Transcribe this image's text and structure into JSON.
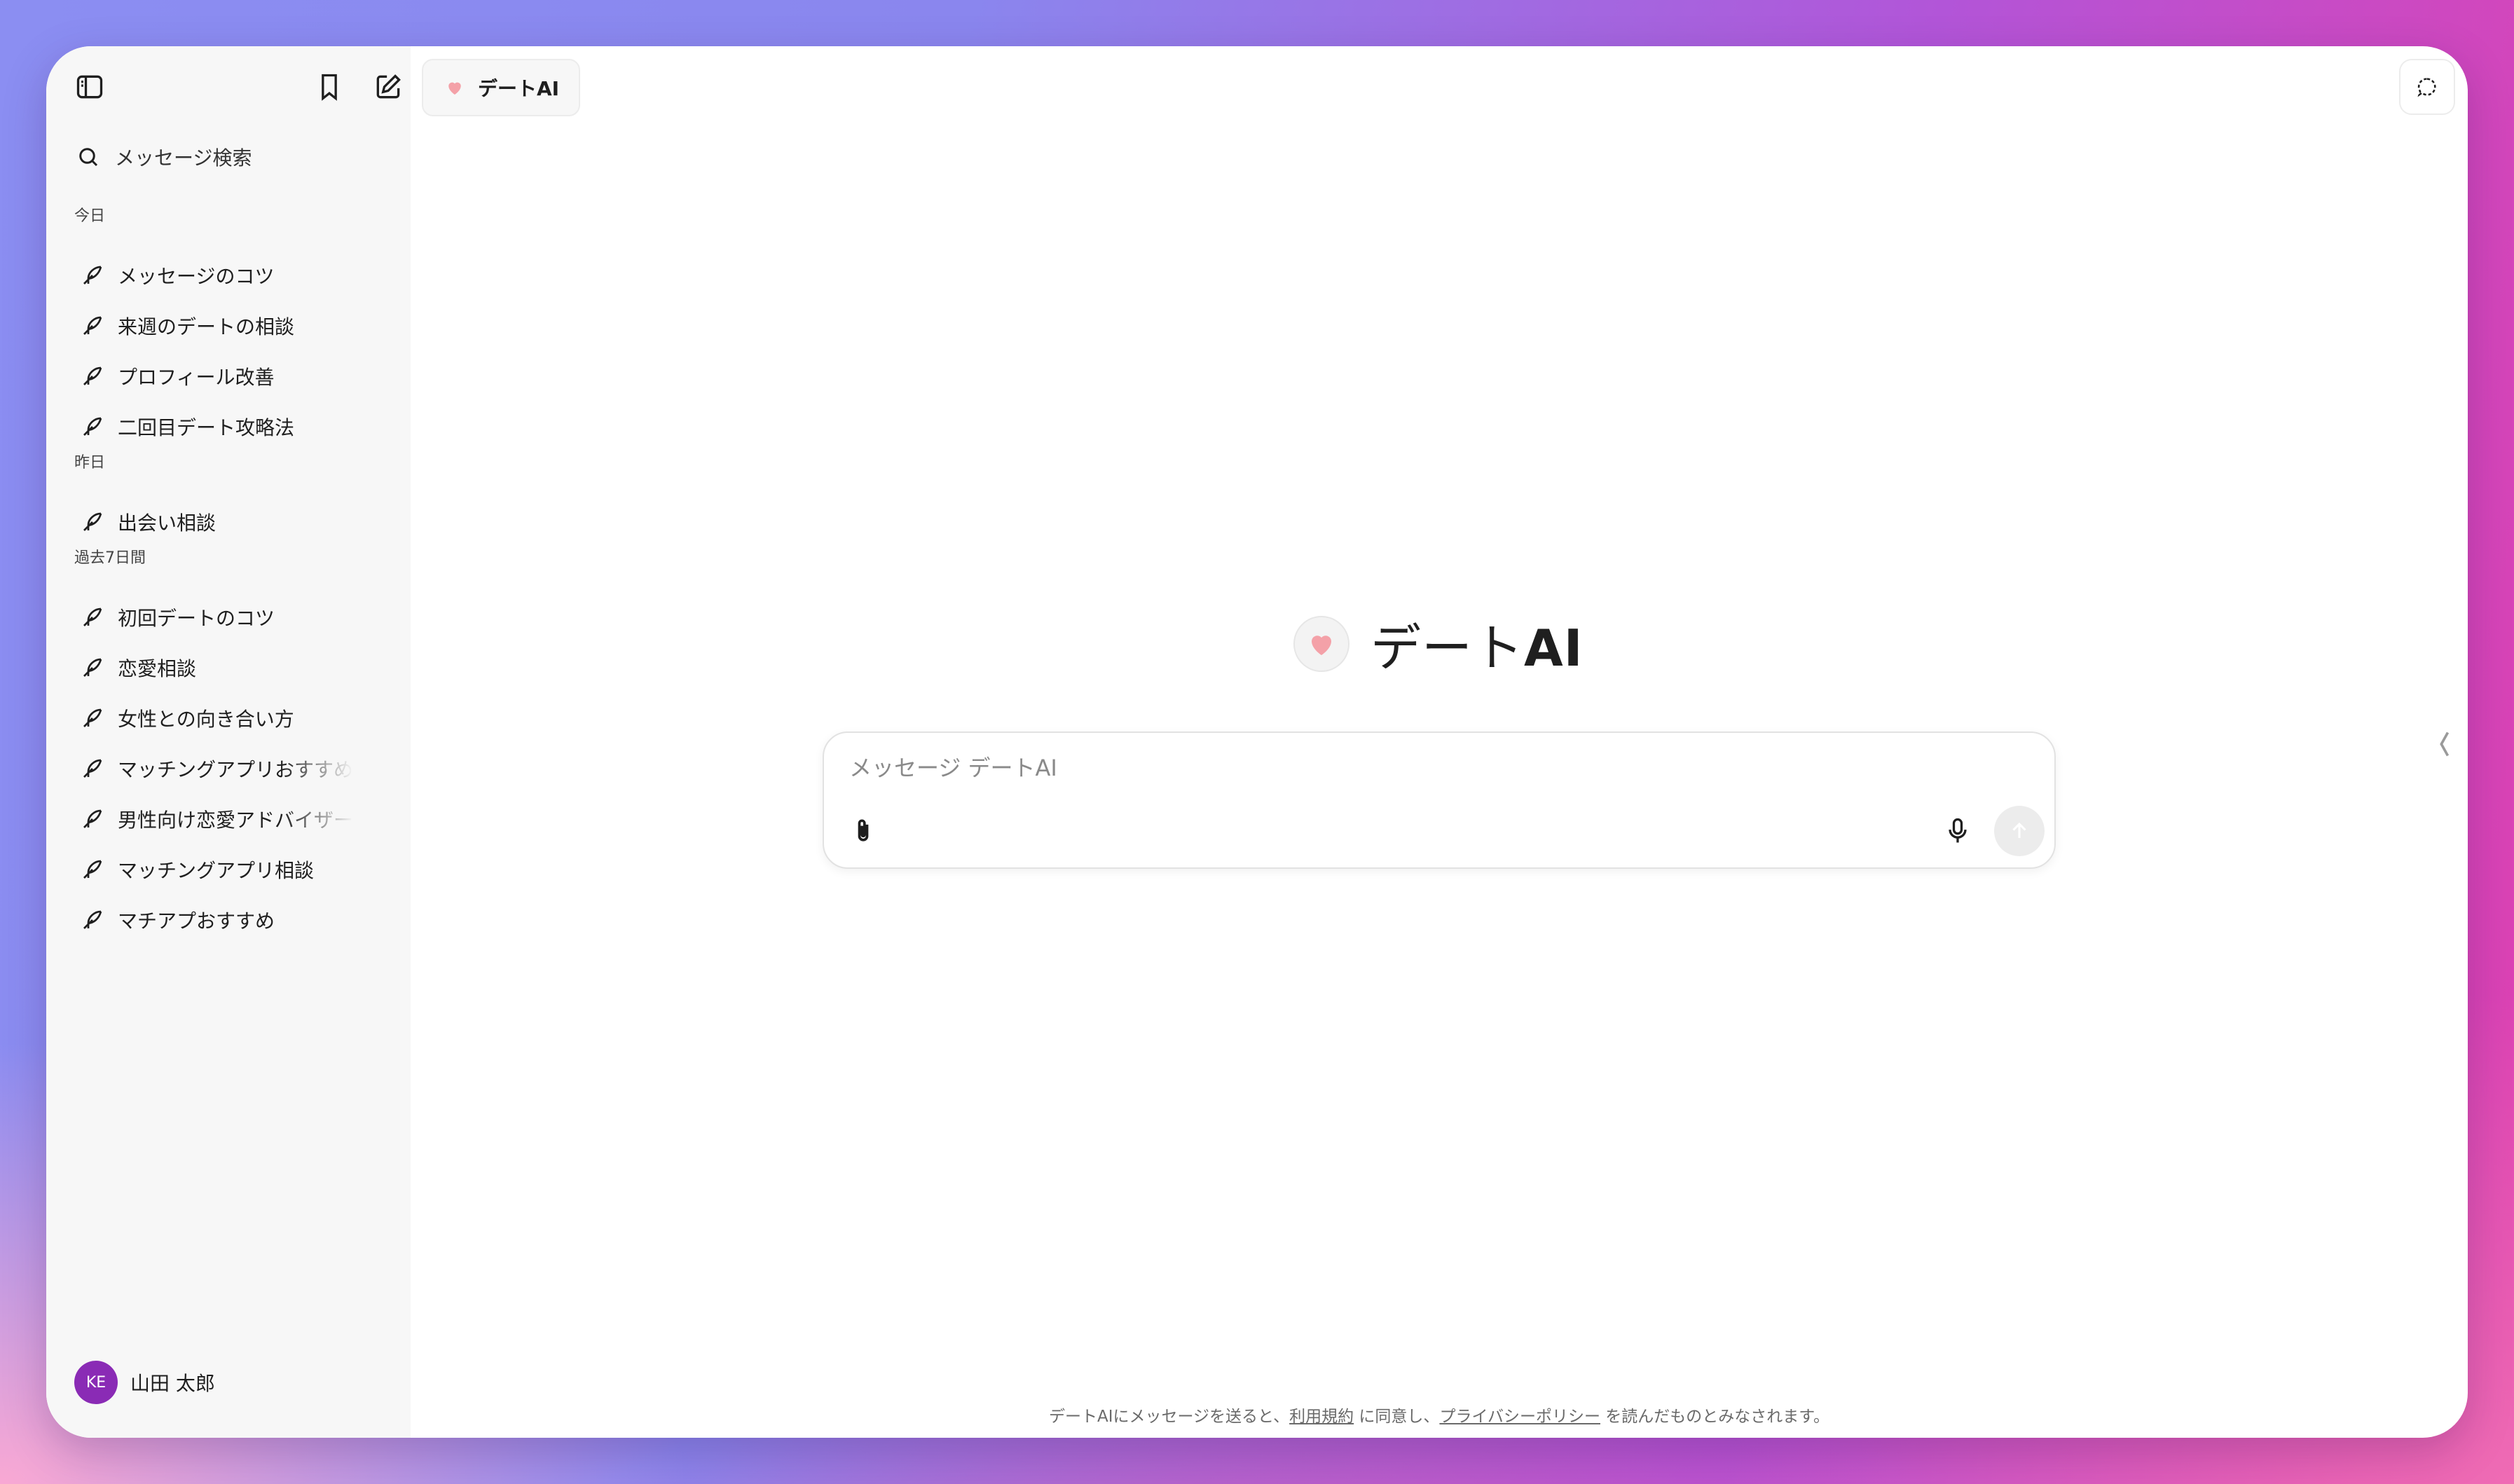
{
  "app": {
    "name": "デートAI"
  },
  "sidebar": {
    "search_label": "メッセージ検索",
    "sections": [
      {
        "label": "今日",
        "items": [
          "メッセージのコツ",
          "来週のデートの相談",
          "プロフィール改善",
          "二回目デート攻略法"
        ]
      },
      {
        "label": "昨日",
        "items": [
          "出会い相談"
        ]
      },
      {
        "label": "過去7日間",
        "items": [
          "初回デートのコツ",
          "恋愛相談",
          "女性との向き合い方",
          "マッチングアプリおすすめ",
          "男性向け恋愛アドバイザー",
          "マッチングアプリ相談",
          "マチアプおすすめ"
        ]
      }
    ],
    "user": {
      "initials": "KE",
      "name": "山田 太郎"
    }
  },
  "header": {
    "model_label": "デートAI"
  },
  "hero": {
    "title_prefix": "デート",
    "title_suffix": "AI"
  },
  "composer": {
    "placeholder": "メッセージ デートAI",
    "value": ""
  },
  "footer": {
    "text_before": "デートAIにメッセージを送ると、",
    "terms_link": "利用規約",
    "text_middle": " に同意し、",
    "privacy_link": "プライバシーポリシー",
    "text_after": " を読んだものとみなされます。"
  },
  "colors": {
    "accent_heart": "#f4a1a8",
    "avatar_bg": "#8a2bb5",
    "sidebar_bg": "#f7f7f7"
  },
  "icons": [
    "sidebar-toggle-icon",
    "bookmark-icon",
    "new-chat-icon",
    "search-icon",
    "feather-icon",
    "heart-icon",
    "chat-bubble-icon",
    "paperclip-icon",
    "microphone-icon",
    "arrow-up-icon",
    "chevron-left-icon"
  ]
}
